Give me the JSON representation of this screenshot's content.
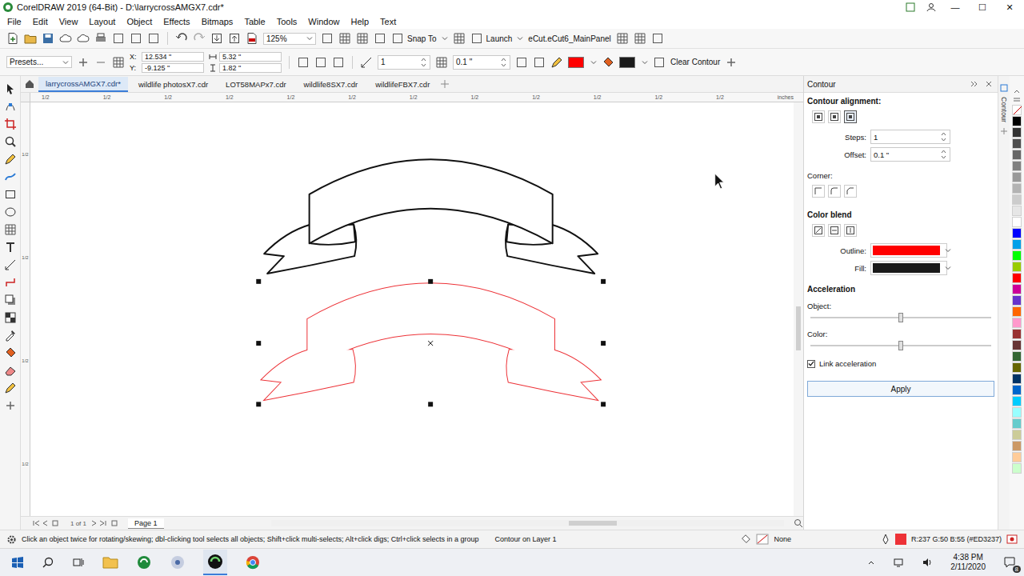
{
  "window": {
    "title": "CorelDRAW 2019 (64-Bit) - D:\\larrycrossAMGX7.cdr*",
    "controls": [
      "—",
      "☐",
      "✕"
    ]
  },
  "menu": [
    "File",
    "Edit",
    "View",
    "Layout",
    "Object",
    "Effects",
    "Bitmaps",
    "Table",
    "Tools",
    "Window",
    "Help",
    "Text"
  ],
  "toolbar": {
    "zoom": "125%",
    "snap": "Snap To",
    "launch": "Launch",
    "panel": "eCut.eCut6_MainPanel"
  },
  "property_bar": {
    "presets": "Presets...",
    "x_label": "X:",
    "x": "12.534 \"",
    "y_label": "Y:",
    "y": "-9.125 \"",
    "width": "5.32 \"",
    "height": "1.82 \"",
    "steps": "1",
    "offset": "0.1 \"",
    "outline_color": "#FF0000",
    "fill_color": "#1A1A1A",
    "clear": "Clear Contour"
  },
  "doc_tabs": [
    {
      "label": "larrycrossAMGX7.cdr*",
      "selected": true
    },
    {
      "label": "wildlife photosX7.cdr",
      "selected": false
    },
    {
      "label": "LOT58MAPx7.cdr",
      "selected": false
    },
    {
      "label": "wildlife8SX7.cdr",
      "selected": false
    },
    {
      "label": "wildlifeFBX7.cdr",
      "selected": false
    }
  ],
  "ruler": {
    "unit": "inches",
    "marks": [
      "1/2",
      "1/2",
      "1/2",
      "1/2",
      "1/2",
      "1/2",
      "1/2",
      "1/2",
      "1/2",
      "1/2",
      "1/2",
      "1/2"
    ],
    "side_marks": [
      "1/2",
      "1/2",
      "1/2",
      "1/2"
    ]
  },
  "canvas": {
    "contour_color": "#ED3237"
  },
  "docker": {
    "title": "Contour",
    "side_tab": "Contour",
    "alignment_label": "Contour alignment:",
    "alignment": [
      {
        "selected": false
      },
      {
        "selected": false
      },
      {
        "selected": true
      }
    ],
    "steps_label": "Steps:",
    "steps": "1",
    "offset_label": "Offset:",
    "offset": "0.1 \"",
    "corner_label": "Corner:",
    "color_blend_label": "Color blend",
    "outline_label": "Outline:",
    "outline_color": "#FF0000",
    "fill_label": "Fill:",
    "fill_color": "#1A1A1A",
    "acceleration_label": "Acceleration",
    "sliders": [
      {
        "label": "Object:",
        "level": 0.5
      },
      {
        "label": "Color:",
        "level": 0.5
      }
    ],
    "link": {
      "label": "Link acceleration",
      "checked": true
    },
    "apply": "Apply"
  },
  "palette": [
    "#000000",
    "#333333",
    "#4D4D4D",
    "#666666",
    "#808080",
    "#999999",
    "#B3B3B3",
    "#CCCCCC",
    "#E6E6E6",
    "#FFFFFF",
    "#0000FF",
    "#00A0E9",
    "#00FF00",
    "#99CC00",
    "#FF0000",
    "#CC0099",
    "#6633CC",
    "#FF6600",
    "#FF99CC",
    "#993333",
    "#663333",
    "#336633",
    "#666600",
    "#003366",
    "#0066CC",
    "#00CCFF",
    "#99FFFF",
    "#66CCCC",
    "#CCCC99",
    "#CC9966",
    "#FFCC99",
    "#CCFFCC"
  ],
  "page_nav": {
    "current": "1",
    "of": "of",
    "total": "1",
    "page": "Page 1"
  },
  "status": {
    "hint": "Click an object twice for rotating/skewing; dbl-clicking tool selects all objects; Shift+click multi-selects; Alt+click digs; Ctrl+click selects in a group",
    "layer": "Contour on Layer 1",
    "fill": "None",
    "outline_color": "#ED3237",
    "color": "R:237 G:50 B:55 (#ED3237)"
  },
  "taskbar": {
    "time": "4:38 PM",
    "date": "2/11/2020",
    "notifications": "8"
  }
}
